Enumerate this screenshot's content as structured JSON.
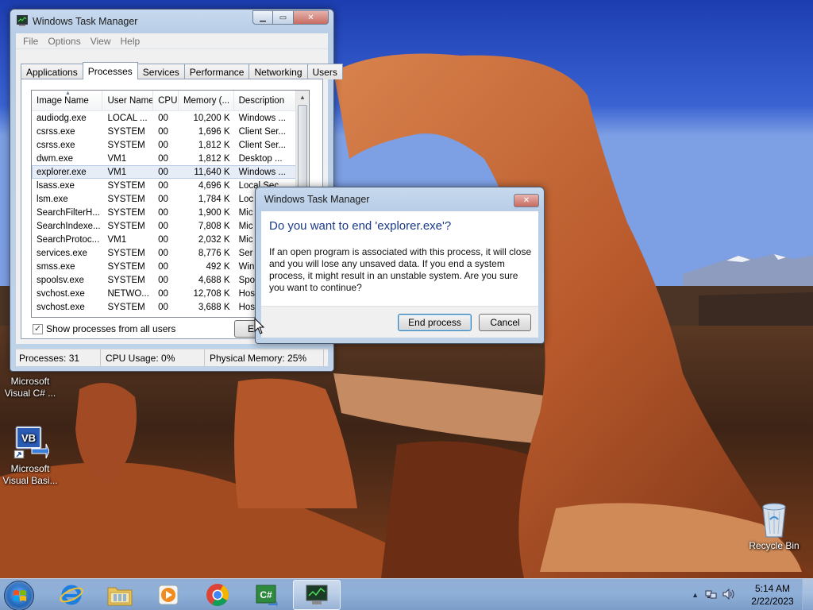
{
  "desktop": {
    "icons": [
      {
        "label": "Microsoft Visual C# ...",
        "icon": "visual-csharp-icon"
      },
      {
        "label": "Microsoft Visual Basi...",
        "icon": "visual-basic-icon"
      },
      {
        "label": "Recycle Bin",
        "icon": "recycle-bin-icon"
      }
    ],
    "vb_badge": "VB"
  },
  "taskmgr": {
    "title": "Windows Task Manager",
    "menu": [
      "File",
      "Options",
      "View",
      "Help"
    ],
    "tabs": [
      "Applications",
      "Processes",
      "Services",
      "Performance",
      "Networking",
      "Users"
    ],
    "active_tab": "Processes",
    "columns": [
      "Image Name",
      "User Name",
      "CPU",
      "Memory (...",
      "Description"
    ],
    "rows": [
      {
        "image": "audiodg.exe",
        "user": "LOCAL ...",
        "cpu": "00",
        "mem": "10,200 K",
        "desc": "Windows ..."
      },
      {
        "image": "csrss.exe",
        "user": "SYSTEM",
        "cpu": "00",
        "mem": "1,696 K",
        "desc": "Client Ser..."
      },
      {
        "image": "csrss.exe",
        "user": "SYSTEM",
        "cpu": "00",
        "mem": "1,812 K",
        "desc": "Client Ser..."
      },
      {
        "image": "dwm.exe",
        "user": "VM1",
        "cpu": "00",
        "mem": "1,812 K",
        "desc": "Desktop ..."
      },
      {
        "image": "explorer.exe",
        "user": "VM1",
        "cpu": "00",
        "mem": "11,640 K",
        "desc": "Windows ...",
        "selected": true
      },
      {
        "image": "lsass.exe",
        "user": "SYSTEM",
        "cpu": "00",
        "mem": "4,696 K",
        "desc": "Local Sec..."
      },
      {
        "image": "lsm.exe",
        "user": "SYSTEM",
        "cpu": "00",
        "mem": "1,784 K",
        "desc": "Loc"
      },
      {
        "image": "SearchFilterH...",
        "user": "SYSTEM",
        "cpu": "00",
        "mem": "1,900 K",
        "desc": "Mic"
      },
      {
        "image": "SearchIndexe...",
        "user": "SYSTEM",
        "cpu": "00",
        "mem": "7,808 K",
        "desc": "Mic"
      },
      {
        "image": "SearchProtoc...",
        "user": "VM1",
        "cpu": "00",
        "mem": "2,032 K",
        "desc": "Mic"
      },
      {
        "image": "services.exe",
        "user": "SYSTEM",
        "cpu": "00",
        "mem": "8,776 K",
        "desc": "Ser"
      },
      {
        "image": "smss.exe",
        "user": "SYSTEM",
        "cpu": "00",
        "mem": "492 K",
        "desc": "Win"
      },
      {
        "image": "spoolsv.exe",
        "user": "SYSTEM",
        "cpu": "00",
        "mem": "4,688 K",
        "desc": "Spo"
      },
      {
        "image": "svchost.exe",
        "user": "NETWO...",
        "cpu": "00",
        "mem": "12,708 K",
        "desc": "Hos"
      },
      {
        "image": "svchost.exe",
        "user": "SYSTEM",
        "cpu": "00",
        "mem": "3,688 K",
        "desc": "Hos"
      }
    ],
    "show_all_label": "Show processes from all users",
    "show_all_checked": true,
    "end_process_partial": "E",
    "status": {
      "processes": "Processes: 31",
      "cpu": "CPU Usage: 0%",
      "memory": "Physical Memory: 25%"
    }
  },
  "dialog": {
    "title": "Windows Task Manager",
    "heading": "Do you want to end 'explorer.exe'?",
    "body": "If an open program is associated with this process, it will close and you will lose any unsaved data. If you end a system process, it might result in an unstable system. Are you sure you want to continue?",
    "confirm_label": "End process",
    "cancel_label": "Cancel"
  },
  "taskbar": {
    "apps": [
      "start-orb-icon",
      "internet-explorer-icon",
      "windows-explorer-icon",
      "media-player-icon",
      "chrome-icon",
      "visual-csharp-icon",
      "task-manager-icon"
    ],
    "time": "5:14 AM",
    "date": "2/22/2023"
  },
  "colors": {
    "accent": "#1a3a8a",
    "selection": "#e6edf7",
    "close_button": "#c86c61"
  }
}
